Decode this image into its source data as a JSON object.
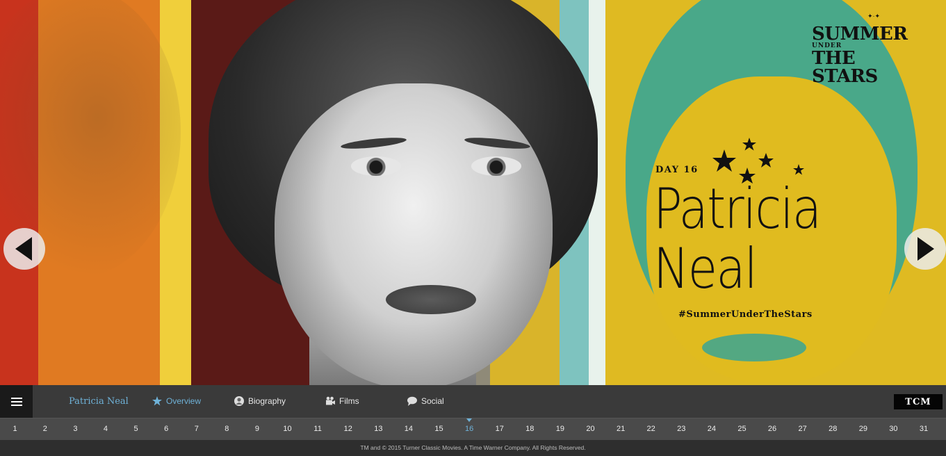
{
  "hero": {
    "brand": {
      "line1": "SUMMER",
      "line2": "UNDER",
      "line3": "THE STARS"
    },
    "day_label": "DAY 16",
    "star_first": "Patricia",
    "star_last": "Neal",
    "hashtag": "#SummerUnderTheStars",
    "prev_icon": "chevron-left-icon",
    "next_icon": "chevron-right-icon"
  },
  "nav": {
    "menu_icon": "hamburger-menu-icon",
    "star_name": "Patricia Neal",
    "items": [
      {
        "label": "Overview",
        "icon": "star-icon",
        "active": true
      },
      {
        "label": "Biography",
        "icon": "person-icon",
        "active": false
      },
      {
        "label": "Films",
        "icon": "film-camera-icon",
        "active": false
      },
      {
        "label": "Social",
        "icon": "speech-bubble-icon",
        "active": false
      }
    ],
    "logo": "TCM"
  },
  "days": [
    "1",
    "2",
    "3",
    "4",
    "5",
    "6",
    "7",
    "8",
    "9",
    "10",
    "11",
    "12",
    "13",
    "14",
    "15",
    "16",
    "17",
    "18",
    "19",
    "20",
    "21",
    "22",
    "23",
    "24",
    "25",
    "26",
    "27",
    "28",
    "29",
    "30",
    "31"
  ],
  "active_day": "16",
  "footer": {
    "text": "TM and © 2015 Turner Classic Movies. A Time Warner Company. All Rights Reserved."
  },
  "colors": {
    "accent": "#6fb2d8",
    "navbar": "#3a3a3a",
    "daybar": "#4a4a4a"
  }
}
